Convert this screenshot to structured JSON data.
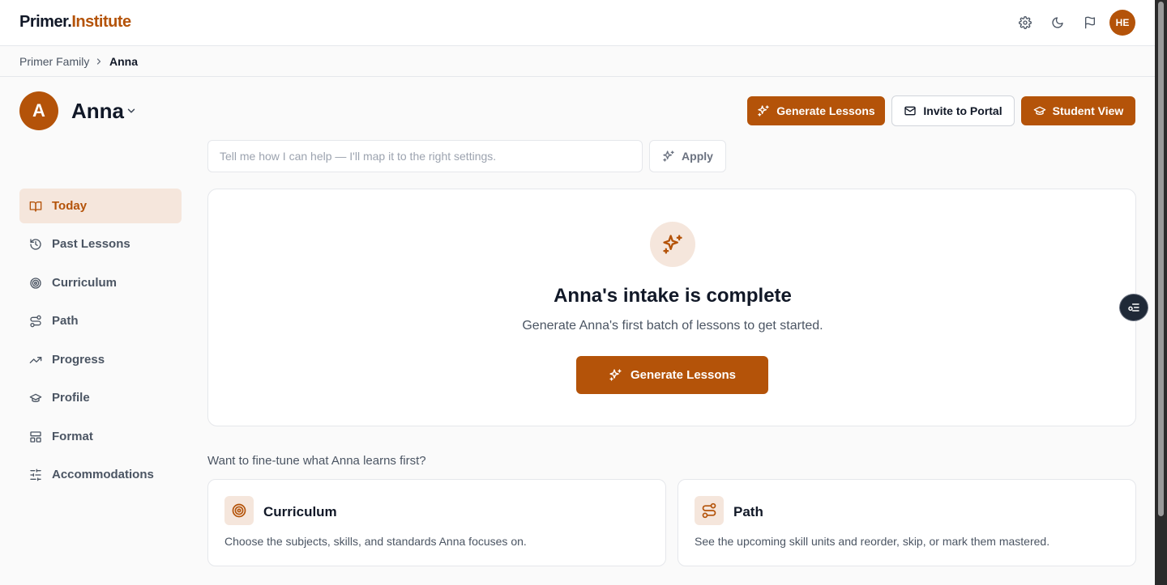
{
  "header": {
    "logo_primary": "Primer.",
    "logo_secondary": "Institute",
    "icons": [
      "gear-icon",
      "moon-icon",
      "flag-icon"
    ],
    "user_initials": "HE"
  },
  "breadcrumb": {
    "parent": "Primer Family",
    "current": "Anna"
  },
  "student": {
    "initial": "A",
    "name": "Anna"
  },
  "actions": {
    "generate_label": "Generate Lessons",
    "invite_label": "Invite to Portal",
    "student_view_label": "Student View"
  },
  "assistant": {
    "placeholder": "Tell me how I can help — I'll map it to the right settings.",
    "value": "",
    "apply_label": "Apply"
  },
  "sidebar": {
    "items": [
      {
        "label": "Today",
        "icon": "book-open-icon",
        "active": true
      },
      {
        "label": "Past Lessons",
        "icon": "history-icon",
        "active": false
      },
      {
        "label": "Curriculum",
        "icon": "target-icon",
        "active": false
      },
      {
        "label": "Path",
        "icon": "route-icon",
        "active": false
      },
      {
        "label": "Progress",
        "icon": "trending-up-icon",
        "active": false
      },
      {
        "label": "Profile",
        "icon": "graduation-cap-icon",
        "active": false
      },
      {
        "label": "Format",
        "icon": "layout-icon",
        "active": false
      },
      {
        "label": "Accommodations",
        "icon": "sliders-icon",
        "active": false
      }
    ]
  },
  "hero": {
    "icon": "sparkles-icon",
    "title": "Anna's intake is complete",
    "subtitle": "Generate Anna's first batch of lessons to get started.",
    "button_label": "Generate Lessons"
  },
  "finetune": {
    "heading": "Want to fine-tune what Anna learns first?",
    "cards": [
      {
        "title": "Curriculum",
        "icon": "target-icon",
        "description": "Choose the subjects, skills, and standards Anna focuses on."
      },
      {
        "title": "Path",
        "icon": "route-icon",
        "description": "See the upcoming skill units and reorder, skip, or mark them mastered."
      }
    ]
  },
  "colors": {
    "accent": "#b45309",
    "accent_soft": "#f5e6dc",
    "text_dark": "#111827",
    "text_muted": "#4b5563"
  }
}
